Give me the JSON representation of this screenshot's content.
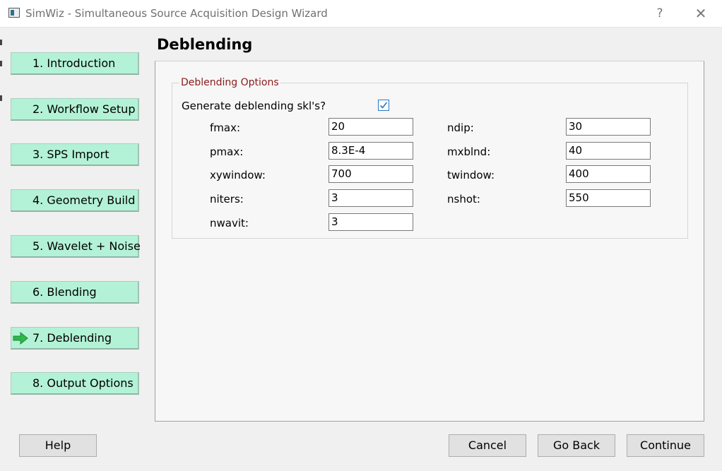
{
  "window": {
    "title": "SimWiz - Simultaneous Source Acquisition Design Wizard",
    "help_glyph": "?",
    "close_glyph": "✕"
  },
  "colors": {
    "nav_button_bg": "#b3f2d6",
    "current_step_arrow": "#2db84a",
    "group_title": "#8b1a1a",
    "checkbox_accent": "#2a78c2"
  },
  "sidebar": {
    "current_step_icon": "arrow-right-icon",
    "steps": [
      {
        "label": "1. Introduction",
        "current": false
      },
      {
        "label": "2. Workflow Setup",
        "current": false
      },
      {
        "label": "3. SPS Import",
        "current": false
      },
      {
        "label": "4. Geometry Build",
        "current": false
      },
      {
        "label": "5. Wavelet + Noise",
        "current": false
      },
      {
        "label": "6. Blending",
        "current": false
      },
      {
        "label": "7. Deblending",
        "current": true
      },
      {
        "label": "8. Output Options",
        "current": false
      }
    ]
  },
  "main": {
    "title": "Deblending",
    "group": {
      "title": "Deblending Options",
      "generate_label": "Generate deblending skl's?",
      "generate_checked": true,
      "fields": {
        "fmax": {
          "label": "fmax:",
          "value": "20"
        },
        "pmax": {
          "label": "pmax:",
          "value": "8.3E-4"
        },
        "xywindow": {
          "label": "xywindow:",
          "value": "700"
        },
        "niters": {
          "label": "niters:",
          "value": "3"
        },
        "nwavit": {
          "label": "nwavit:",
          "value": "3"
        },
        "ndip": {
          "label": "ndip:",
          "value": "30"
        },
        "mxblnd": {
          "label": "mxblnd:",
          "value": "40"
        },
        "twindow": {
          "label": "twindow:",
          "value": "400"
        },
        "nshot": {
          "label": "nshot:",
          "value": "550"
        }
      }
    }
  },
  "footer": {
    "help_label": "Help",
    "cancel_label": "Cancel",
    "go_back_label": "Go Back",
    "continue_label": "Continue"
  }
}
